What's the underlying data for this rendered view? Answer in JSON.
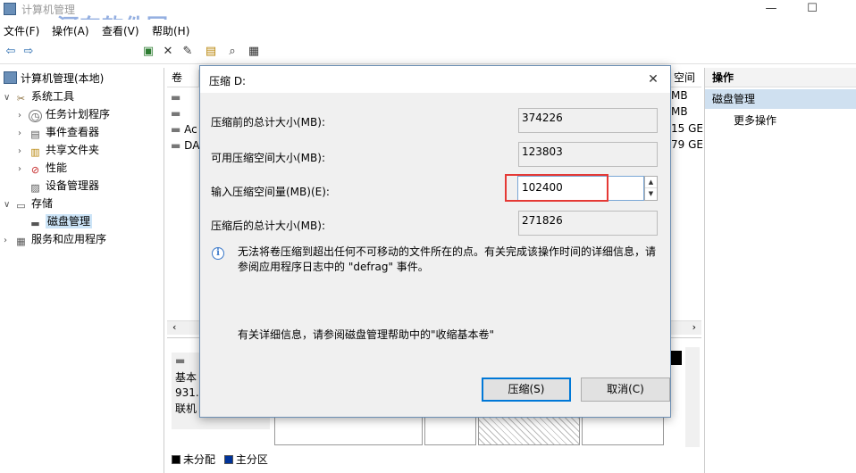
{
  "window": {
    "title": "计算机管理"
  },
  "watermark": {
    "text": "河东软件园",
    "site": "www.pc0359.cn"
  },
  "menu": {
    "items": [
      "文件(F)",
      "操作(A)",
      "查看(V)",
      "帮助(H)"
    ]
  },
  "tree": {
    "root": "计算机管理(本地)",
    "system_tools": "系统工具",
    "task_scheduler": "任务计划程序",
    "event_viewer": "事件查看器",
    "shared_folders": "共享文件夹",
    "performance": "性能",
    "device_manager": "设备管理器",
    "storage": "存储",
    "disk_management": "磁盘管理",
    "services_apps": "服务和应用程序"
  },
  "center": {
    "col_volume": "卷",
    "col_free": "空间",
    "frag_ac": "Ac",
    "frag_da": "DA",
    "free_values": [
      "MB",
      "MB",
      "15 GE",
      "79 GE"
    ],
    "disk_label_lines": [
      "基本",
      "931.",
      "联机"
    ],
    "legend_unallocated": "未分配",
    "legend_primary": "主分区"
  },
  "actions": {
    "header": "操作",
    "section": "磁盘管理",
    "more": "更多操作"
  },
  "dialog": {
    "title": "压缩 D:",
    "total_before_label": "压缩前的总计大小(MB):",
    "total_before_value": "374226",
    "available_label": "可用压缩空间大小(MB):",
    "available_value": "123803",
    "input_label": "输入压缩空间量(MB)(E):",
    "input_value": "102400",
    "total_after_label": "压缩后的总计大小(MB):",
    "total_after_value": "271826",
    "info_text": "无法将卷压缩到超出任何不可移动的文件所在的点。有关完成该操作时间的详细信息，请参阅应用程序日志中的 \"defrag\" 事件。",
    "help_text": "有关详细信息，请参阅磁盘管理帮助中的\"收缩基本卷\"",
    "shrink_button": "压缩(S)",
    "cancel_button": "取消(C)"
  },
  "colors": {
    "accent": "#0078d7",
    "highlight": "#e53935",
    "primary_partition": "#003399"
  }
}
